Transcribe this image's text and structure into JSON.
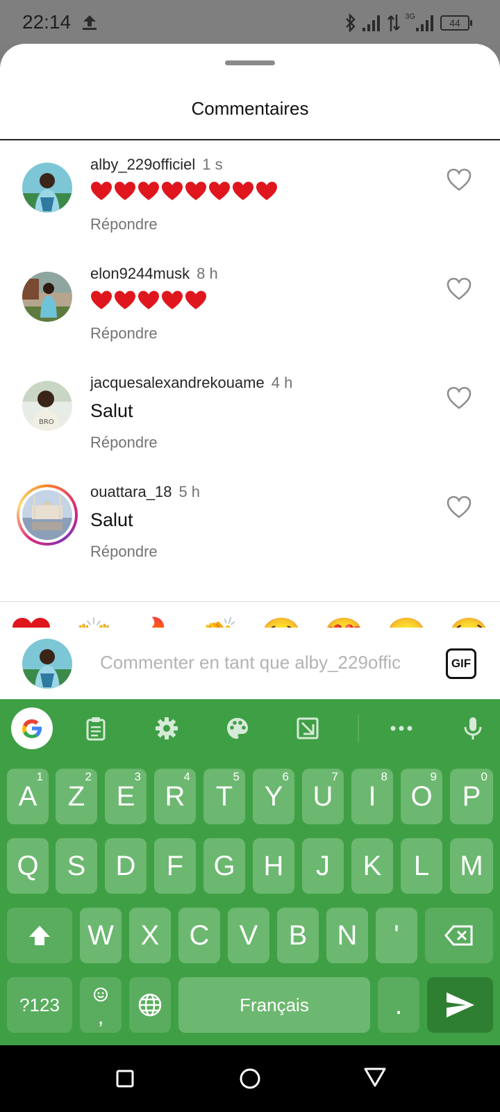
{
  "status_bar": {
    "time": "22:14",
    "network": "3G",
    "battery": "44"
  },
  "sheet": {
    "title": "Commentaires"
  },
  "comments": [
    {
      "user": "alby_229officiel",
      "time": "1 s",
      "text": "❤️❤️❤️❤️❤️❤️❤️❤️",
      "hearts": 8,
      "reply": "Répondre"
    },
    {
      "user": "elon9244musk",
      "time": "8 h",
      "text": "❤️❤️❤️❤️❤️",
      "hearts": 5,
      "reply": "Répondre"
    },
    {
      "user": "jacquesalexandrekouame",
      "time": "4 h",
      "text": "Salut",
      "reply": "Répondre"
    },
    {
      "user": "ouattara_18",
      "time": "5 h",
      "text": "Salut",
      "reply": "Répondre"
    }
  ],
  "quick_emojis": [
    "❤️",
    "🙌",
    "🔥",
    "👏",
    "😢",
    "😍",
    "😮",
    "😂"
  ],
  "compose": {
    "placeholder": "Commenter en tant que alby_229offic",
    "gif_label": "GIF"
  },
  "keyboard": {
    "row1": [
      {
        "key": "A",
        "hint": "1"
      },
      {
        "key": "Z",
        "hint": "2"
      },
      {
        "key": "E",
        "hint": "3"
      },
      {
        "key": "R",
        "hint": "4"
      },
      {
        "key": "T",
        "hint": "5"
      },
      {
        "key": "Y",
        "hint": "6"
      },
      {
        "key": "U",
        "hint": "7"
      },
      {
        "key": "I",
        "hint": "8"
      },
      {
        "key": "O",
        "hint": "9"
      },
      {
        "key": "P",
        "hint": "0"
      }
    ],
    "row2": [
      "Q",
      "S",
      "D",
      "F",
      "G",
      "H",
      "J",
      "K",
      "L",
      "M"
    ],
    "row3": [
      "W",
      "X",
      "C",
      "V",
      "B",
      "N",
      "'"
    ],
    "symbols_key": "?123",
    "comma_key": ",",
    "space_label": "Français",
    "period_key": "."
  },
  "colors": {
    "keyboard_bg": "#3f9f45",
    "key_bg": "#6cb870",
    "heart_red": "#e0161e"
  }
}
